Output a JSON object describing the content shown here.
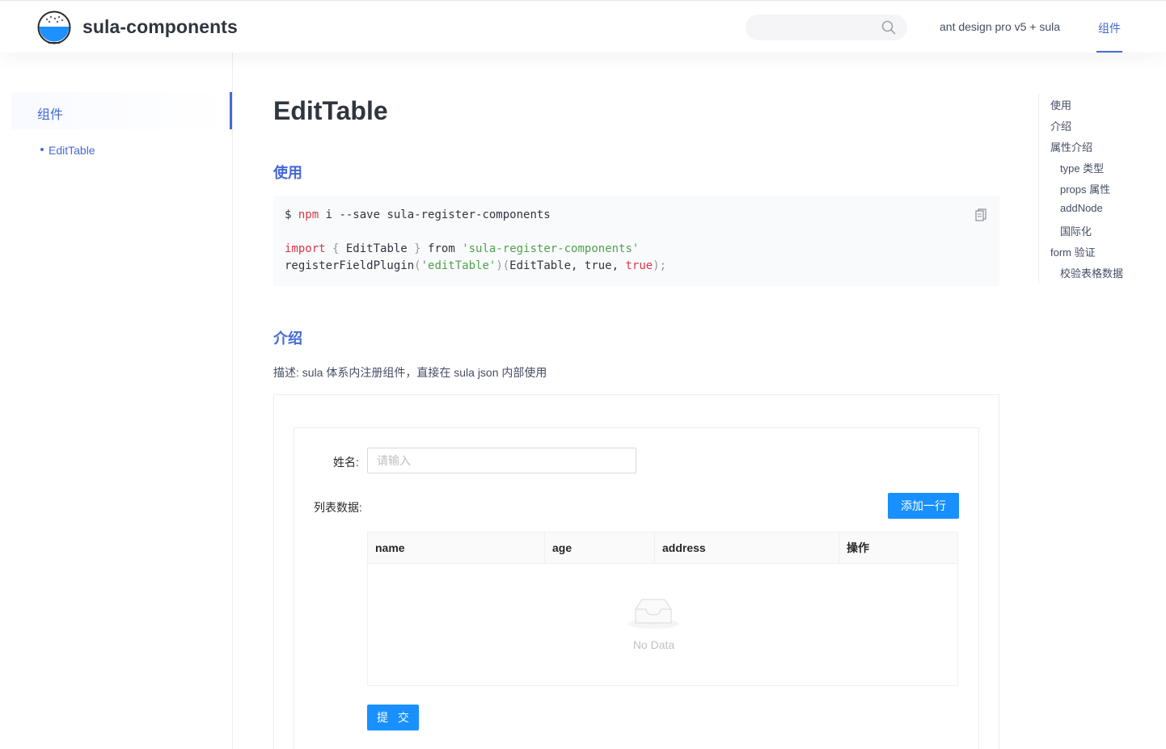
{
  "header": {
    "brand": "sula-components",
    "search_placeholder": "",
    "nav": [
      {
        "label": "ant design pro v5 + sula"
      },
      {
        "label": "组件"
      }
    ]
  },
  "sidebar": {
    "group_label": "组件",
    "items": [
      {
        "label": "EditTable"
      }
    ]
  },
  "main": {
    "title": "EditTable",
    "sections": [
      {
        "heading": "使用"
      },
      {
        "heading": "介绍"
      }
    ],
    "code": {
      "line1_prompt": "$ ",
      "line1_cmd": "npm",
      "line1_rest": " i --save sula-register-components",
      "line2_kw": "import",
      "line2_open": " { ",
      "line2_name": "EditTable",
      "line2_close": " } ",
      "line2_from": "from ",
      "line2_str": "'sula-register-components'",
      "line3_fn": "registerFieldPlugin",
      "line3_paren1": "(",
      "line3_str": "'editTable'",
      "line3_paren2": ")(",
      "line3_args": "EditTable, true, ",
      "line3_true": "true",
      "line3_end": ");"
    },
    "description": "描述: sula 体系内注册组件，直接在 sula json 内部使用",
    "demo": {
      "name_label": "姓名:",
      "name_placeholder": "请输入",
      "list_label": "列表数据:",
      "add_button": "添加一行",
      "columns": [
        "name",
        "age",
        "address",
        "操作"
      ],
      "empty_text": "No Data",
      "submit_button": "提 交"
    }
  },
  "toc": [
    {
      "label": "使用",
      "level": 1
    },
    {
      "label": "介绍",
      "level": 1
    },
    {
      "label": "属性介绍",
      "level": 1
    },
    {
      "label": "type 类型",
      "level": 2
    },
    {
      "label": "props 属性",
      "level": 2
    },
    {
      "label": "addNode",
      "level": 2
    },
    {
      "label": "国际化",
      "level": 2
    },
    {
      "label": "form 验证",
      "level": 1
    },
    {
      "label": "校验表格数据",
      "level": 2
    }
  ],
  "colors": {
    "accent": "#4569d4",
    "primary_button": "#1890ff"
  }
}
